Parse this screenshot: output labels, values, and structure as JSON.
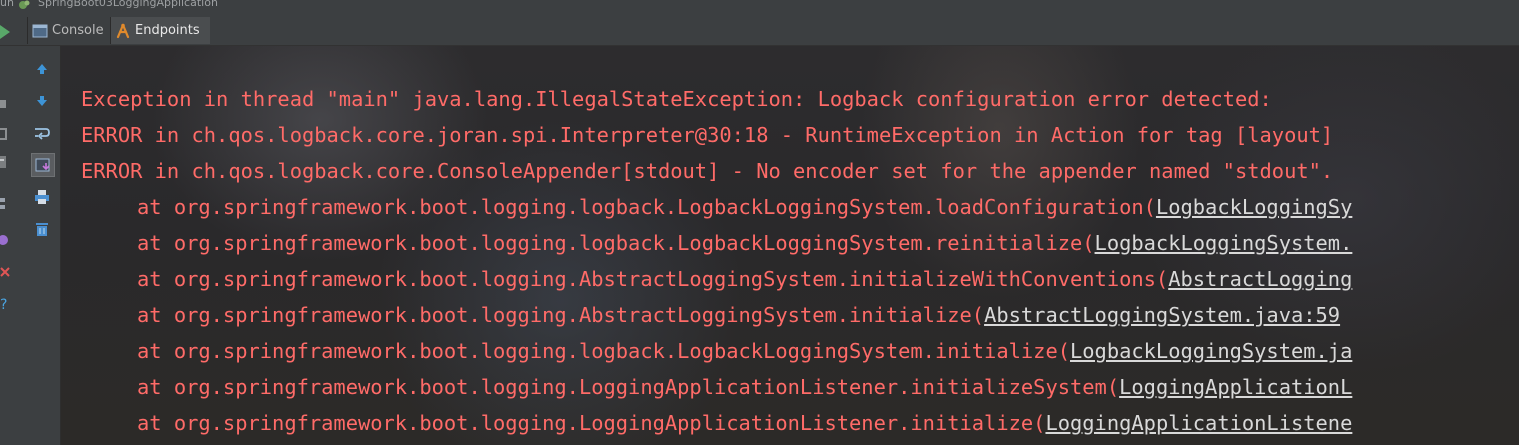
{
  "titlebar": {
    "run_prefix": "un",
    "app_name": "SpringBoot03LoggingApplication"
  },
  "tabs": [
    {
      "label": "Console",
      "icon": "console-icon",
      "active": false
    },
    {
      "label": "Endpoints",
      "icon": "endpoints-icon",
      "active": true
    }
  ],
  "toolbar": {
    "buttons": [
      "up-arrow-icon",
      "down-arrow-icon",
      "soft-wrap-icon",
      "scroll-to-end-icon",
      "print-icon",
      "trash-icon"
    ]
  },
  "colors": {
    "error_text": "#ff6b68",
    "link_text": "#d9d9d9",
    "panel_bg": "#3c3f41"
  },
  "console": {
    "lines": [
      {
        "text": "Exception in thread \"main\" java.lang.IllegalStateException: Logback configuration error detected: ",
        "link": ""
      },
      {
        "text": "ERROR in ch.qos.logback.core.joran.spi.Interpreter@30:18 - RuntimeException in Action for tag [layout] ",
        "link": ""
      },
      {
        "text": "ERROR in ch.qos.logback.core.ConsoleAppender[stdout] - No encoder set for the appender named \"stdout\".",
        "link": ""
      },
      {
        "text": "at org.springframework.boot.logging.logback.LogbackLoggingSystem.loadConfiguration(",
        "link": "LogbackLoggingSy"
      },
      {
        "text": "at org.springframework.boot.logging.logback.LogbackLoggingSystem.reinitialize(",
        "link": "LogbackLoggingSystem."
      },
      {
        "text": "at org.springframework.boot.logging.AbstractLoggingSystem.initializeWithConventions(",
        "link": "AbstractLogging"
      },
      {
        "text": "at org.springframework.boot.logging.AbstractLoggingSystem.initialize(",
        "link": "AbstractLoggingSystem.java:59"
      },
      {
        "text": "at org.springframework.boot.logging.logback.LogbackLoggingSystem.initialize(",
        "link": "LogbackLoggingSystem.ja"
      },
      {
        "text": "at org.springframework.boot.logging.LoggingApplicationListener.initializeSystem(",
        "link": "LoggingApplicationL"
      },
      {
        "text": "at org.springframework.boot.logging.LoggingApplicationListener.initialize(",
        "link": "LoggingApplicationListene"
      }
    ]
  }
}
